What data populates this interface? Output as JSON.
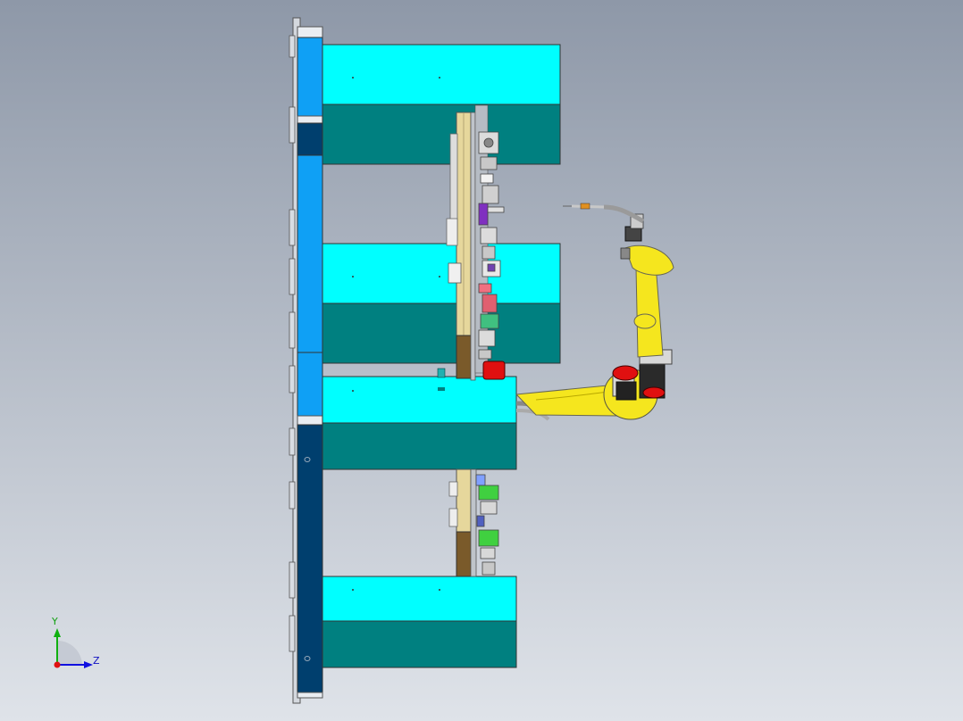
{
  "viewport": {
    "background_top": "#8e98a8",
    "background_bottom": "#dfe3e9"
  },
  "colors": {
    "cyan": "#00ffff",
    "teal": "#008080",
    "blue_light": "#0fa0f5",
    "blue_dark": "#003f6e",
    "tan": "#e6d79c",
    "brown": "#7a5a2a",
    "robot_yellow": "#f5e61e",
    "motor_red": "#e01010",
    "steel": "#c8c8c8",
    "axis_x": "#e01010",
    "axis_y": "#10b010",
    "axis_z": "#1010e0"
  },
  "triad": {
    "y_label": "Y",
    "z_label": "Z",
    "icons": [
      "triad-origin-icon",
      "y-axis-arrow-icon",
      "z-axis-arrow-icon"
    ]
  }
}
